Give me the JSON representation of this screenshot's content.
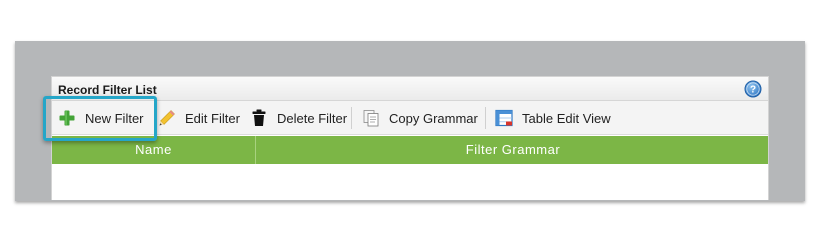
{
  "panel": {
    "title": "Record Filter List",
    "help_icon": "help-icon"
  },
  "toolbar": {
    "buttons": [
      {
        "label": "New Filter",
        "icon": "plus-icon"
      },
      {
        "label": "Edit Filter",
        "icon": "pencil-icon"
      },
      {
        "label": "Delete Filter",
        "icon": "trash-icon"
      },
      {
        "label": "Copy Grammar",
        "icon": "copy-icon"
      },
      {
        "label": "Table Edit View",
        "icon": "table-icon"
      }
    ]
  },
  "grid": {
    "columns": [
      "Name",
      "Filter Grammar"
    ],
    "rows": []
  },
  "colors": {
    "grid_header": "#7cb646",
    "highlight": "#25a6c8",
    "frame": "#b5b7b9"
  }
}
